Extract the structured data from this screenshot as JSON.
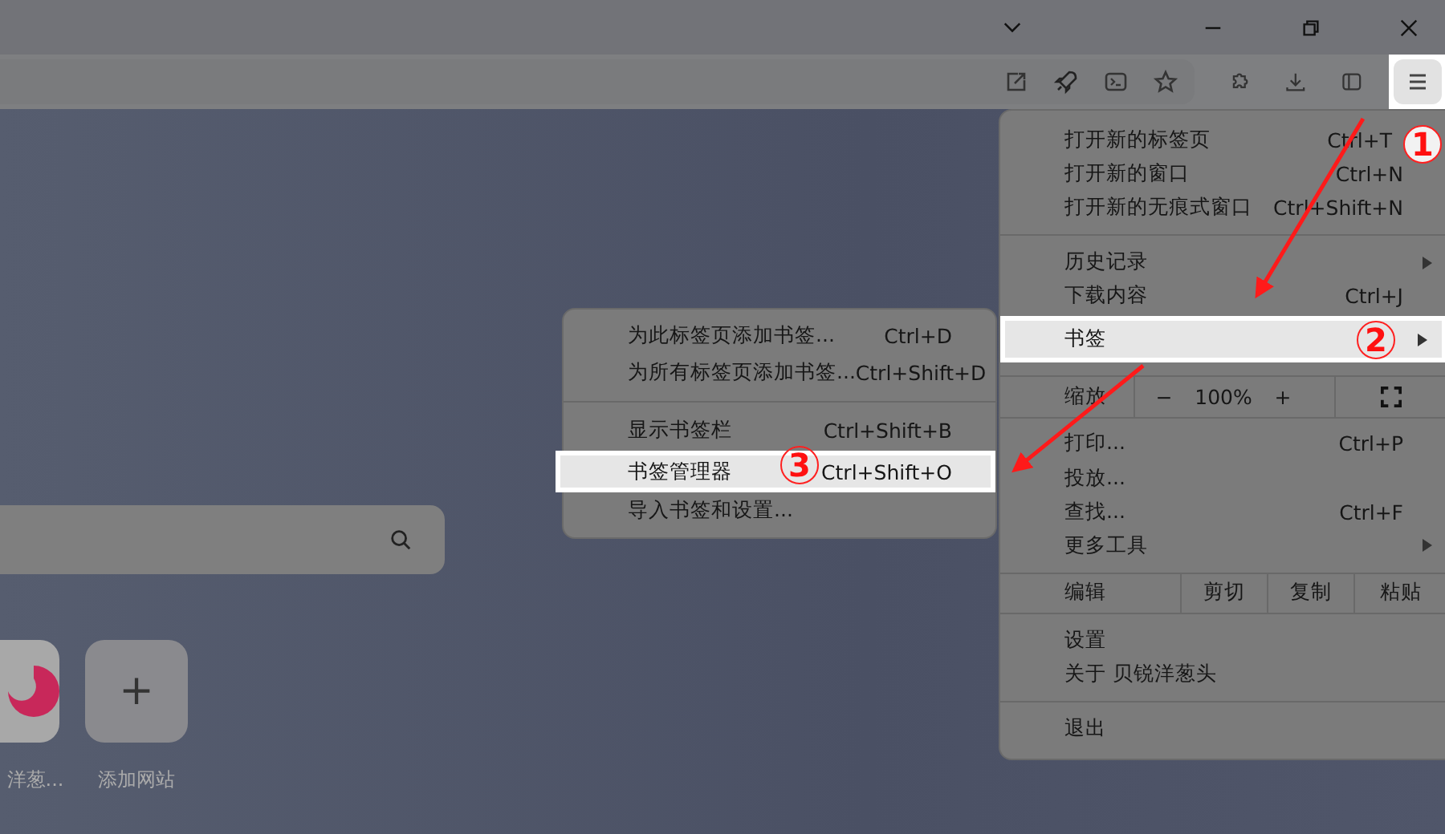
{
  "toolbar": {
    "menu_button": {
      "highlighted": true
    }
  },
  "new_tab": {
    "shortcuts": [
      {
        "kind": "site",
        "label": "洋葱..."
      },
      {
        "kind": "add",
        "label": "添加网站",
        "icon": "+"
      }
    ]
  },
  "main_menu": {
    "items": [
      {
        "kind": "item",
        "label": "打开新的标签页",
        "shortcut": "Ctrl+T",
        "submenu": false,
        "highlighted": false
      },
      {
        "kind": "item",
        "label": "打开新的窗口",
        "shortcut": "Ctrl+N",
        "submenu": false,
        "highlighted": false
      },
      {
        "kind": "item",
        "label": "打开新的无痕式窗口",
        "shortcut": "Ctrl+Shift+N",
        "submenu": false,
        "highlighted": false
      },
      {
        "kind": "separator"
      },
      {
        "kind": "item",
        "label": "历史记录",
        "submenu": true,
        "highlighted": false
      },
      {
        "kind": "item",
        "label": "下载内容",
        "shortcut": "Ctrl+J",
        "submenu": false,
        "highlighted": false
      },
      {
        "kind": "item",
        "label": "书签",
        "submenu": true,
        "highlighted": true
      },
      {
        "kind": "separator"
      },
      {
        "kind": "zoom",
        "label": "缩放",
        "minus": "−",
        "value": "100%",
        "plus": "+"
      },
      {
        "kind": "separator"
      },
      {
        "kind": "item",
        "label": "打印...",
        "shortcut": "Ctrl+P",
        "submenu": false,
        "highlighted": false
      },
      {
        "kind": "item",
        "label": "投放...",
        "submenu": false,
        "highlighted": false
      },
      {
        "kind": "item",
        "label": "查找...",
        "shortcut": "Ctrl+F",
        "submenu": false,
        "highlighted": false
      },
      {
        "kind": "item",
        "label": "更多工具",
        "submenu": true,
        "highlighted": false
      },
      {
        "kind": "separator"
      },
      {
        "kind": "edit",
        "label": "编辑",
        "actions": [
          "剪切",
          "复制",
          "粘贴"
        ]
      },
      {
        "kind": "separator"
      },
      {
        "kind": "item",
        "label": "设置",
        "submenu": false,
        "highlighted": false
      },
      {
        "kind": "item",
        "label": "关于 贝锐洋葱头",
        "submenu": false,
        "highlighted": false
      },
      {
        "kind": "separator"
      },
      {
        "kind": "item",
        "label": "退出",
        "submenu": false,
        "highlighted": false
      }
    ]
  },
  "bookmarks_submenu": {
    "items": [
      {
        "kind": "item",
        "label": "为此标签页添加书签...",
        "shortcut": "Ctrl+D",
        "highlighted": false
      },
      {
        "kind": "item",
        "label": "为所有标签页添加书签...",
        "shortcut": "Ctrl+Shift+D",
        "highlighted": false
      },
      {
        "kind": "separator"
      },
      {
        "kind": "item",
        "label": "显示书签栏",
        "shortcut": "Ctrl+Shift+B",
        "highlighted": false
      },
      {
        "kind": "item",
        "label": "书签管理器",
        "shortcut": "Ctrl+Shift+O",
        "highlighted": true
      },
      {
        "kind": "item",
        "label": "导入书签和设置...",
        "highlighted": false
      }
    ]
  },
  "annotations": {
    "steps": [
      "1",
      "2",
      "3"
    ]
  }
}
